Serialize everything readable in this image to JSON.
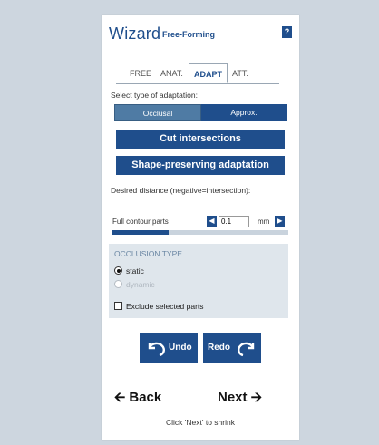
{
  "header": {
    "title": "Wizard",
    "subtitle": "Free-Forming",
    "help_label": "?"
  },
  "tabs": [
    {
      "label": "FREE",
      "active": false
    },
    {
      "label": "ANAT.",
      "active": false
    },
    {
      "label": "ADAPT",
      "active": true
    },
    {
      "label": "ATT.",
      "active": false
    }
  ],
  "adaptation": {
    "prompt": "Select type of adaptation:",
    "options": [
      "Occlusal",
      "Approx."
    ],
    "selected": "Occlusal"
  },
  "actions": {
    "cut_intersections": "Cut intersections",
    "shape_preserving": "Shape-preserving adaptation"
  },
  "distance": {
    "label": "Desired distance (negative=intersection):",
    "row_label": "Full contour parts",
    "value": "0.1",
    "unit": "mm",
    "slider_fraction": 0.32
  },
  "occlusion": {
    "title": "OCCLUSION TYPE",
    "options": [
      {
        "label": "static",
        "selected": true,
        "enabled": true
      },
      {
        "label": "dynamic",
        "selected": false,
        "enabled": false
      }
    ],
    "exclude_label": "Exclude selected parts",
    "exclude_checked": false
  },
  "history": {
    "undo": "Undo",
    "redo": "Redo"
  },
  "navigation": {
    "back": "Back",
    "next": "Next",
    "hint": "Click 'Next' to shrink"
  },
  "colors": {
    "accent": "#1f4e8c",
    "occlusal_selected": "#4f7ba4",
    "background": "#cdd6df"
  }
}
